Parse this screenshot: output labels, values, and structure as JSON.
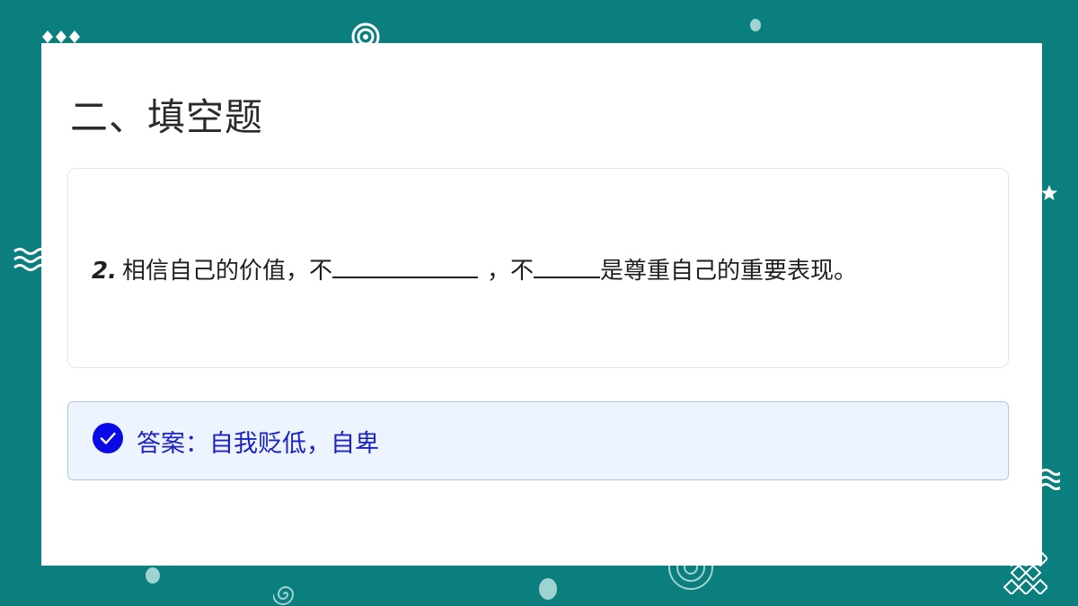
{
  "slide": {
    "title": "二、填空题"
  },
  "question": {
    "number": "2.",
    "text_part1": "相信自己的价值，不",
    "text_part2": "，不",
    "text_part3": "是尊重自己的重要表现。"
  },
  "answer": {
    "label": "答案：",
    "value": "自我贬低，自卑",
    "color": "#1a22c4"
  },
  "colors": {
    "background": "#0a7f7d",
    "check_icon": "#0a0ae6"
  },
  "icons": {
    "check": "check-circle-icon"
  }
}
